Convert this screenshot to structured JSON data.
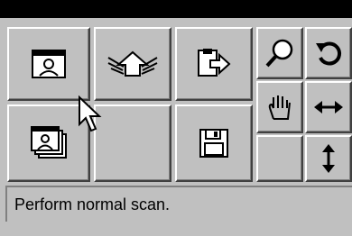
{
  "toolbar": {
    "buttons": [
      {
        "id": "scan-single",
        "icon": "scan-portrait-icon"
      },
      {
        "id": "wings-up",
        "icon": "winged-up-arrow-icon"
      },
      {
        "id": "export",
        "icon": "document-export-icon"
      },
      {
        "id": "zoom",
        "icon": "magnifier-icon"
      },
      {
        "id": "rotate",
        "icon": "rotate-icon"
      },
      {
        "id": "scan-multi",
        "icon": "scan-multiple-portraits-icon"
      },
      {
        "id": "blank",
        "icon": ""
      },
      {
        "id": "save",
        "icon": "floppy-disk-icon"
      },
      {
        "id": "hand",
        "icon": "hand-pan-icon"
      },
      {
        "id": "horizontal",
        "icon": "horizontal-arrow-icon"
      },
      {
        "id": "blank2",
        "icon": ""
      },
      {
        "id": "vertical",
        "icon": "vertical-arrow-icon"
      }
    ]
  },
  "status": {
    "text": "Perform normal scan."
  }
}
